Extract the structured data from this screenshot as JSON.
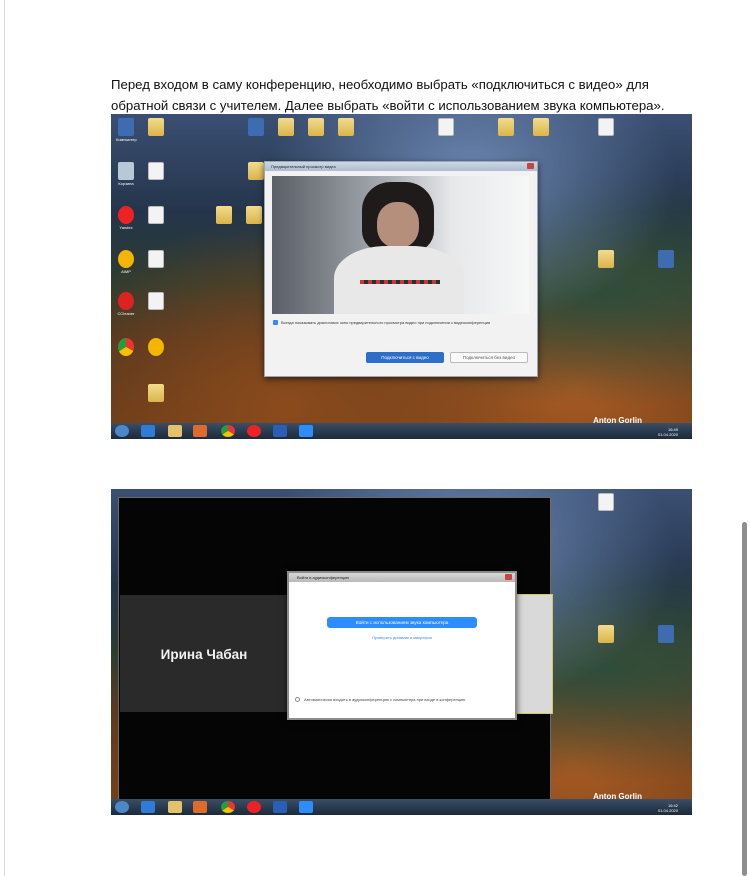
{
  "paragraph": "Перед входом в саму конференцию, необходимо выбрать «подключиться с видео» для обратной связи с учителем. Далее выбрать «войти с использованием звука компьютера».",
  "screenshot1": {
    "preview_window_title": "Предварительный просмотр видео",
    "always_show_checkbox_text": "Всегда показывать диалоговое окно предварительного просмотра видео при подключении к видеоконференции",
    "join_with_video_button": "Подключиться с видео",
    "join_without_video_button": "Подключиться без видео",
    "wallpaper_credit": "Anton Gorlin",
    "tray_time": "16:49",
    "tray_date": "01.04.2020",
    "desktop_icons": [
      "Компьютер",
      "Корзина",
      "Yandex",
      "AIMP",
      "CCleaner"
    ]
  },
  "screenshot2": {
    "audio_window_title": "Войти в аудиоконференцию",
    "participant_name": "Ирина Чабан",
    "join_audio_button": "Войти с использованием звука компьютера",
    "test_audio_link": "Проверить динамик и микрофон",
    "auto_join_checkbox_text": "Автоматически входить в аудиоконференцию с компьютера при входе в конференцию",
    "wallpaper_credit": "Anton Gorlin",
    "tray_time": "16:42",
    "tray_date": "01.04.2020"
  }
}
